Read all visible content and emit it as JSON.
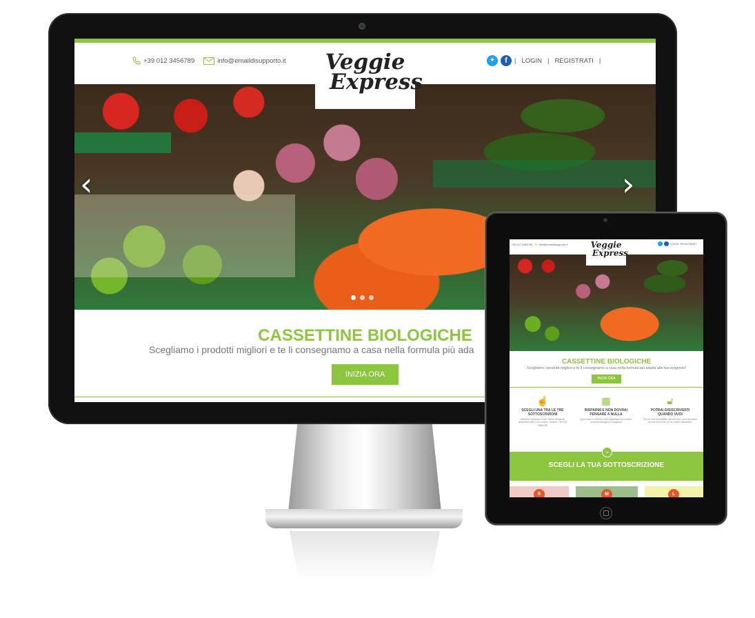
{
  "desktop": {
    "header": {
      "phone": "+39 012 3456789",
      "email": "info@emaildisupporto.it",
      "logo_line1": "Veggie",
      "logo_line2": "Express",
      "login": "LOGIN",
      "register": "REGISTRATI",
      "separator": "|"
    },
    "hero": {
      "title": "CASSETTINE BIOLOGICHE",
      "subtitle": "Scegliamo i prodotti migliori e te li consegnamo a casa nella formula più ada",
      "cta": "INIZIA ORA",
      "prev": "‹",
      "next": "›",
      "slides_count": 3,
      "active_slide": 1
    }
  },
  "tablet": {
    "header": {
      "phone": "+39 012 3456789",
      "email": "info@emaildisupporto.it",
      "logo_line1": "Veggie",
      "logo_line2": "Express",
      "login": "LOGIN",
      "register": "REGISTRATI"
    },
    "hero": {
      "title": "CASSETTINE BIOLOGICHE",
      "subtitle": "Scegliamo i prodotti migliori e te li consegnamo a casa nella formula più adatta alle tue esigenze!",
      "cta": "INIZIA ORA"
    },
    "features": [
      {
        "icon": "touch-icon",
        "title": "SCEGLI UNA TRA LE TRE SOTTOSCRIZIONI",
        "desc": "Abbiamo pensato a tutti, meno deciderai personalizzare il tuo ordine, chiama +39 012 3456789"
      },
      {
        "icon": "calendar-icon",
        "title": "RISPARMI E NON DOVRAI PENSARE A NULLA",
        "desc": "Ogni mese ti arriverà una cassettina con frutta e verdura biologica di stagione"
      },
      {
        "icon": "lock-icon",
        "title": "POTRAI DISISCRIVERTI QUANDO VUOI",
        "desc": "Se non sei soddisfatto del servizio, puoi decidere di non riceverne più le nostre cassettine"
      }
    ],
    "band": {
      "title": "SCEGLI LA TUA SOTTOSCRIZIONE",
      "chevron": "⌄"
    },
    "plans": [
      {
        "letter": "S",
        "bg": "#f3c9c6"
      },
      {
        "letter": "M",
        "bg": "#9cbf8a"
      },
      {
        "letter": "L",
        "bg": "#f2f3a8"
      }
    ]
  },
  "colors": {
    "accent": "#8cc63f",
    "plan_badge": "#e8542a",
    "twitter": "#1da1f2",
    "facebook": "#1e5db4"
  }
}
